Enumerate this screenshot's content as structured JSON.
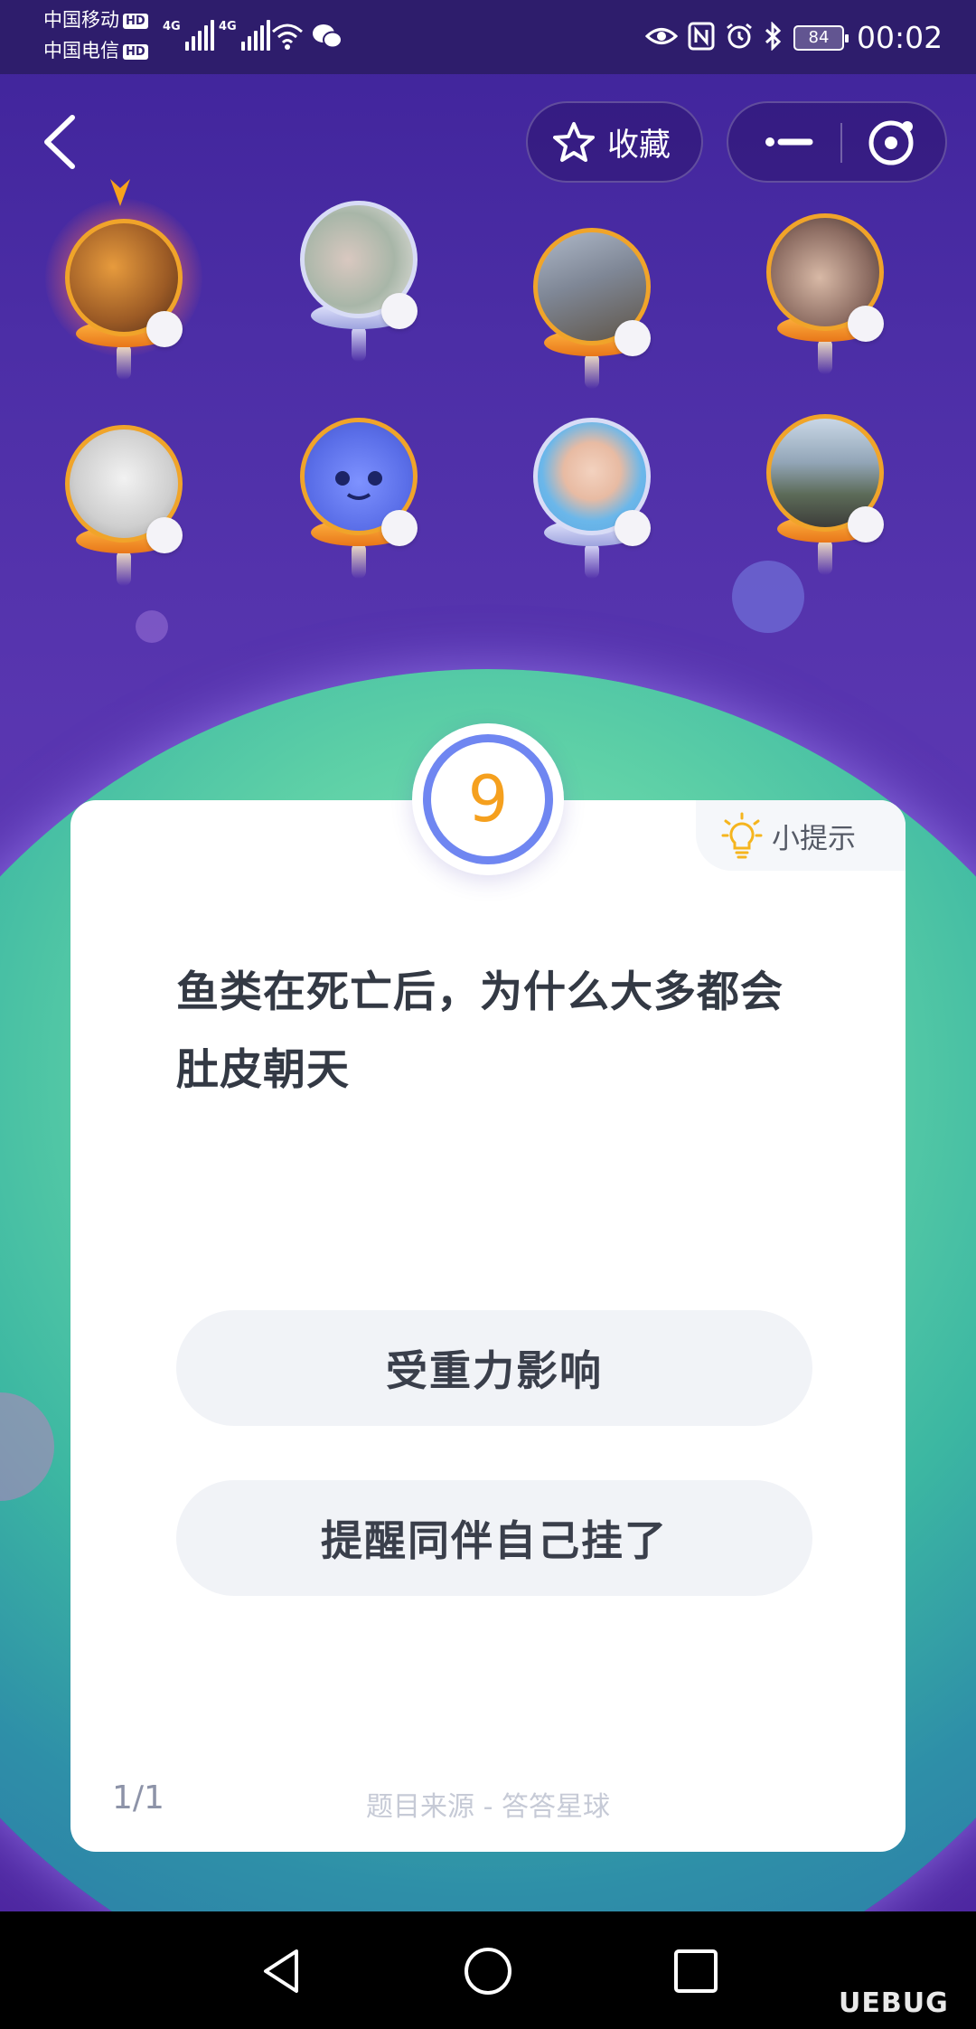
{
  "status_bar": {
    "carrier1": "中国移动",
    "carrier2": "中国电信",
    "hd_badge": "HD",
    "network1": "4G",
    "network2": "4G",
    "battery": "84",
    "time": "00:02"
  },
  "header": {
    "favorite_label": "收藏"
  },
  "players": [
    {
      "icon": "avatar-photo-child-orange",
      "tier": "gold",
      "active": true
    },
    {
      "icon": "avatar-plum-blossom",
      "tier": "silver"
    },
    {
      "icon": "avatar-city-building",
      "tier": "gold"
    },
    {
      "icon": "avatar-girl-selfie",
      "tier": "gold"
    },
    {
      "icon": "avatar-anime-sketch",
      "tier": "gold"
    },
    {
      "icon": "avatar-blue-cat-cartoon",
      "tier": "gold"
    },
    {
      "icon": "avatar-young-man",
      "tier": "silver"
    },
    {
      "icon": "avatar-family-photo",
      "tier": "gold"
    }
  ],
  "question": {
    "number": "9",
    "hint_label": "小提示",
    "text": "鱼类在死亡后，为什么大多都会肚皮朝天",
    "options": [
      "受重力影响",
      "提醒同伴自己挂了"
    ],
    "page": "1/1",
    "source": "题目来源 - 答答星球"
  },
  "watermark": "UEBUG",
  "colors": {
    "accent_ring": "#6f86f1",
    "number": "#f5a01e",
    "gold_frame": "#f0a42a"
  }
}
